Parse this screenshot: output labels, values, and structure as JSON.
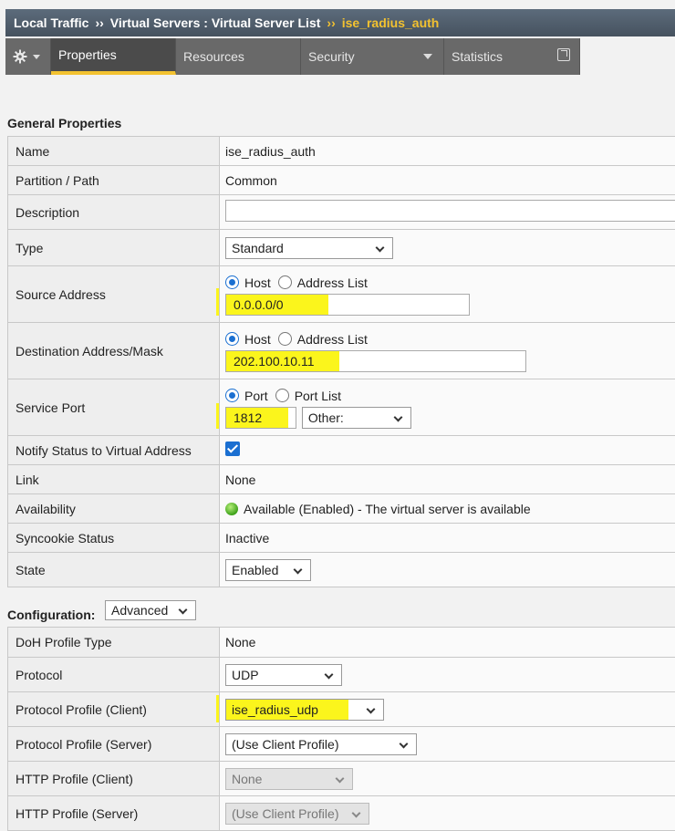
{
  "breadcrumb": {
    "section": "Local Traffic",
    "separator": "››",
    "page": "Virtual Servers : Virtual Server List",
    "current": "ise_radius_auth"
  },
  "tabs": [
    {
      "label": "Properties",
      "active": true
    },
    {
      "label": "Resources"
    },
    {
      "label": "Security"
    },
    {
      "label": "Statistics"
    }
  ],
  "icons": {
    "settings": "gear-icon",
    "external": "external-link-icon"
  },
  "general": {
    "heading": "General Properties",
    "name": {
      "label": "Name",
      "value": "ise_radius_auth"
    },
    "partition": {
      "label": "Partition / Path",
      "value": "Common"
    },
    "description": {
      "label": "Description",
      "value": ""
    },
    "type": {
      "label": "Type",
      "value": "Standard"
    },
    "source": {
      "label": "Source Address",
      "opt1": "Host",
      "opt2": "Address List",
      "value": "0.0.0.0/0"
    },
    "destination": {
      "label": "Destination Address/Mask",
      "opt1": "Host",
      "opt2": "Address List",
      "value": "202.100.10.11"
    },
    "service_port": {
      "label": "Service Port",
      "opt1": "Port",
      "opt2": "Port List",
      "value": "1812",
      "select": "Other:"
    },
    "notify": {
      "label": "Notify Status to Virtual Address",
      "checked": true
    },
    "link": {
      "label": "Link",
      "value": "None"
    },
    "availability": {
      "label": "Availability",
      "value": "Available (Enabled) - The virtual server is available"
    },
    "syncookie": {
      "label": "Syncookie Status",
      "value": "Inactive"
    },
    "state": {
      "label": "State",
      "value": "Enabled"
    }
  },
  "configuration": {
    "heading": "Configuration:",
    "mode": "Advanced",
    "doh": {
      "label": "DoH Profile Type",
      "value": "None"
    },
    "protocol": {
      "label": "Protocol",
      "value": "UDP"
    },
    "profile_client": {
      "label": "Protocol Profile (Client)",
      "value": "ise_radius_udp"
    },
    "profile_server": {
      "label": "Protocol Profile (Server)",
      "value": "(Use Client Profile)"
    },
    "http_client": {
      "label": "HTTP Profile (Client)",
      "value": "None"
    },
    "http_server": {
      "label": "HTTP Profile (Server)",
      "value": "(Use Client Profile)"
    }
  },
  "colors": {
    "highlight": "#fbf51c",
    "accent": "#f3c230",
    "selected": "#1a6fd1"
  }
}
